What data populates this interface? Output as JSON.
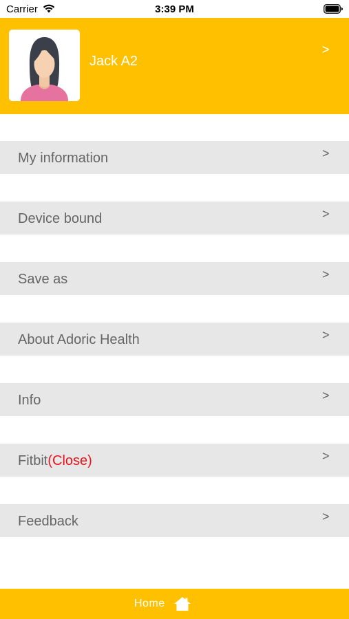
{
  "status_bar": {
    "carrier": "Carrier",
    "time": "3:39 PM",
    "wifi_icon": "wifi-icon",
    "battery_icon": "battery-icon"
  },
  "profile": {
    "name": "Jack A2",
    "chevron": ">",
    "avatar_icon": "female-avatar-icon"
  },
  "menu": {
    "items": [
      {
        "label": "My information",
        "chevron": ">"
      },
      {
        "label": "Device bound",
        "chevron": ">"
      },
      {
        "label": "Save as",
        "chevron": ">"
      },
      {
        "label": "About Adoric Health",
        "chevron": ">"
      },
      {
        "label": "Info",
        "chevron": ">"
      },
      {
        "label": "Fitbit",
        "status": "(Close)",
        "chevron": ">"
      },
      {
        "label": "Feedback",
        "chevron": ">"
      }
    ]
  },
  "bottom_bar": {
    "home_label": "Home",
    "home_icon": "home-icon"
  },
  "colors": {
    "accent": "#ffc000",
    "menu_background": "#e7e7e7",
    "menu_text": "#666666",
    "status_closed": "#e8131c"
  }
}
